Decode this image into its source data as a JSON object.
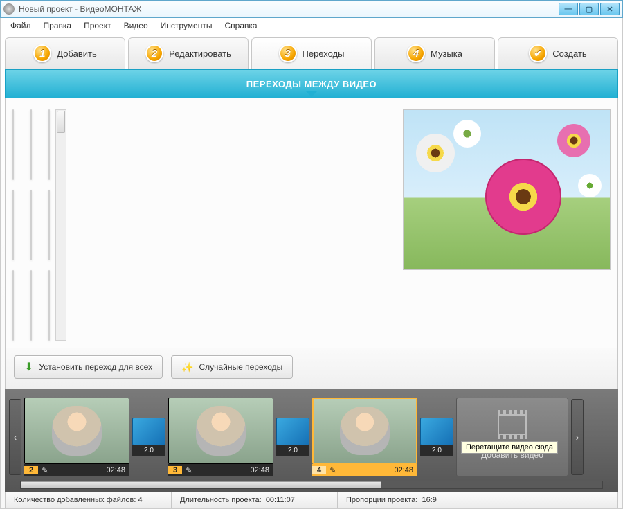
{
  "window": {
    "title": "Новый проект - ВидеоМОНТАЖ"
  },
  "menu": {
    "items": [
      "Файл",
      "Правка",
      "Проект",
      "Видео",
      "Инструменты",
      "Справка"
    ]
  },
  "tabs": [
    {
      "num": "1",
      "label": "Добавить"
    },
    {
      "num": "2",
      "label": "Редактировать"
    },
    {
      "num": "3",
      "label": "Переходы"
    },
    {
      "num": "4",
      "label": "Музыка"
    },
    {
      "num": "✓",
      "label": "Создать"
    }
  ],
  "banner": {
    "title": "ПЕРЕХОДЫ МЕЖДУ ВИДЕО"
  },
  "buttons": {
    "apply_all": "Установить переход для всех",
    "random": "Случайные переходы"
  },
  "timeline": {
    "clips": [
      {
        "num": "2",
        "time": "02:48"
      },
      {
        "num": "3",
        "time": "02:48"
      },
      {
        "num": "4",
        "time": "02:48"
      }
    ],
    "transition_duration": "2.0",
    "add_slot": {
      "tooltip": "Перетащите видео сюда",
      "label": "Добавить видео"
    }
  },
  "status": {
    "files_label": "Количество добавленных файлов:",
    "files_value": "4",
    "duration_label": "Длительность проекта:",
    "duration_value": "00:11:07",
    "aspect_label": "Пропорции проекта:",
    "aspect_value": "16:9"
  },
  "icons": {
    "pencil": "✎",
    "down_arrow": "↓",
    "diag_arrow": "↔",
    "left": "‹",
    "right": "›"
  }
}
